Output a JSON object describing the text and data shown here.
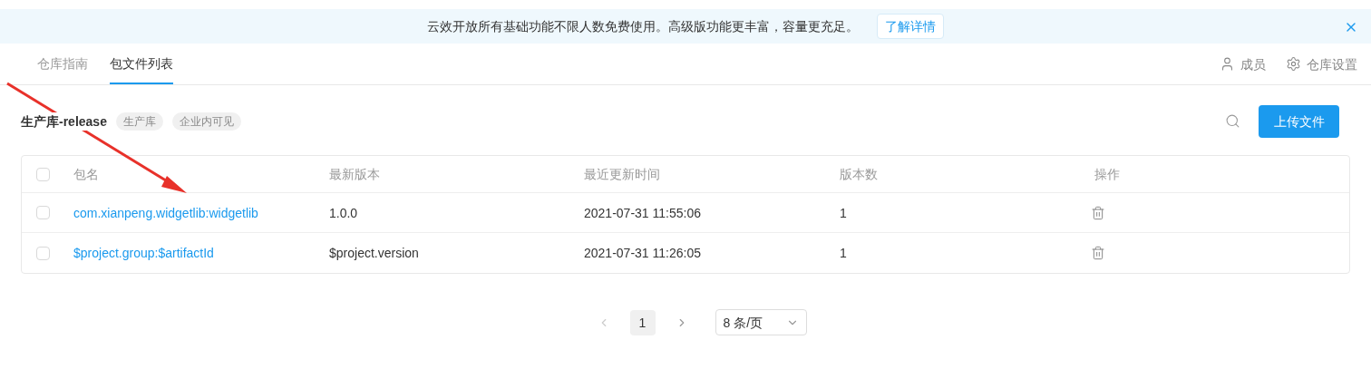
{
  "banner": {
    "message": "云效开放所有基础功能不限人数免费使用。高级版功能更丰富，容量更充足。",
    "link": "了解详情"
  },
  "tabs": [
    {
      "label": "仓库指南",
      "selected": false
    },
    {
      "label": "包文件列表",
      "selected": true
    }
  ],
  "header_actions": [
    {
      "kind": "members",
      "label": "成员"
    },
    {
      "kind": "settings",
      "label": "仓库设置"
    }
  ],
  "repository": {
    "name": "生产库-release",
    "tags": [
      "生产库",
      "企业内可见"
    ]
  },
  "upload_button": "上传文件",
  "table": {
    "select_all_checked": false,
    "columns": [
      "包名",
      "最新版本",
      "最近更新时间",
      "版本数",
      "操作"
    ],
    "rows": [
      {
        "checked": false,
        "name": "com.xianpeng.widgetlib:widgetlib",
        "version": "1.0.0",
        "updated": "2021-07-31 11:55:06",
        "count": "1"
      },
      {
        "checked": false,
        "name": "$project.group:$artifactId",
        "version": "$project.version",
        "updated": "2021-07-31 11:26:05",
        "count": "1"
      }
    ]
  },
  "pagination": {
    "pages": [
      {
        "label": "1",
        "selected": true
      }
    ],
    "page_size": "8 条/页"
  }
}
